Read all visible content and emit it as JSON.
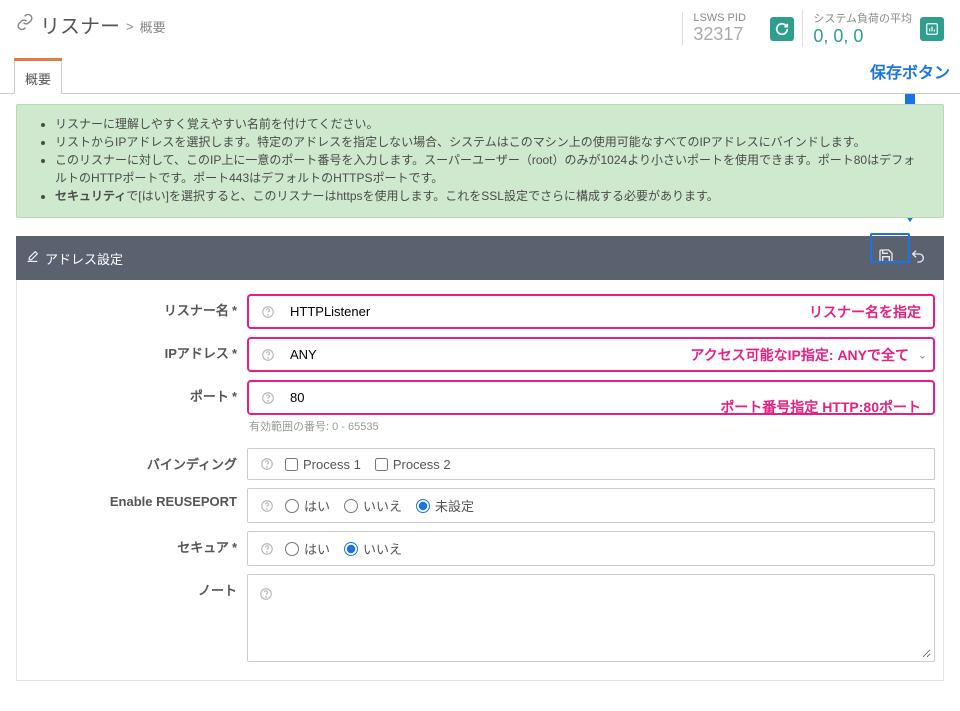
{
  "header": {
    "title_main": "リスナー",
    "title_sep": ">",
    "title_sub": "概要",
    "pid_label": "LSWS PID",
    "pid_value": "32317",
    "load_label": "システム負荷の平均",
    "load_value": "0, 0, 0"
  },
  "tabs": [
    {
      "label": "概要",
      "active": true
    }
  ],
  "save_callout": "保存ボタン",
  "help": {
    "items": [
      "リスナーに理解しやすく覚えやすい名前を付けてください。",
      "リストからIPアドレスを選択します。特定のアドレスを指定しない場合、システムはこのマシン上の使用可能なすべてのIPアドレスにバインドします。",
      "このリスナーに対して、このIP上に一意のポート番号を入力します。スーパーユーザー（root）のみが1024より小さいポートを使用できます。ポート80はデフォルトのHTTPポートです。ポート443はデフォルトのHTTPSポートです。",
      "<b>セキュリティ</b>で[はい]を選択すると、このリスナーはhttpsを使用します。これをSSL設定でさらに構成する必要があります。"
    ]
  },
  "panel": {
    "title": "アドレス設定"
  },
  "form": {
    "listener_name": {
      "label": "リスナー名",
      "value": "HTTPListener",
      "overlay": "リスナー名を指定"
    },
    "ip_address": {
      "label": "IPアドレス",
      "value": "ANY",
      "overlay": "アクセス可能なIP指定: ANYで全て"
    },
    "port": {
      "label": "ポート",
      "value": "80",
      "overlay": "ポート番号指定 HTTP:80ポート",
      "hint": "有効範囲の番号: 0 - 65535"
    },
    "binding": {
      "label": "バインディング",
      "options": [
        "Process 1",
        "Process 2"
      ]
    },
    "reuseport": {
      "label": "Enable REUSEPORT",
      "options": {
        "yes": "はい",
        "no": "いいえ",
        "unset": "未設定"
      },
      "selected": "unset"
    },
    "secure": {
      "label": "セキュア",
      "options": {
        "yes": "はい",
        "no": "いいえ"
      },
      "selected": "no"
    },
    "note": {
      "label": "ノート",
      "value": ""
    }
  },
  "required_marker": "*"
}
